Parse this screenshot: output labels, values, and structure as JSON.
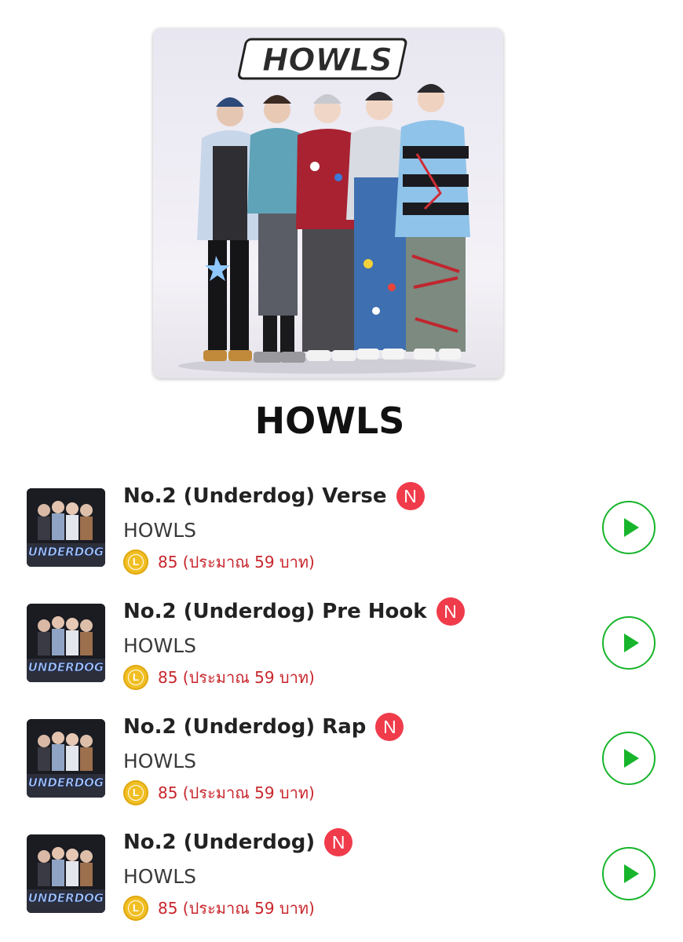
{
  "artist": {
    "logo_text": "HOWLS",
    "name": "HOWLS"
  },
  "tracks": [
    {
      "title": "No.2 (Underdog) Verse",
      "badge": "N",
      "artist": "HOWLS",
      "coin_letter": "L",
      "price": "85 (ประมาณ 59 บาท)",
      "cover_text": "UNDERDOG"
    },
    {
      "title": "No.2 (Underdog) Pre Hook",
      "badge": "N",
      "artist": "HOWLS",
      "coin_letter": "L",
      "price": "85 (ประมาณ 59 บาท)",
      "cover_text": "UNDERDOG"
    },
    {
      "title": "No.2 (Underdog) Rap",
      "badge": "N",
      "artist": "HOWLS",
      "coin_letter": "L",
      "price": "85 (ประมาณ 59 บาท)",
      "cover_text": "UNDERDOG"
    },
    {
      "title": "No.2 (Underdog)",
      "badge": "N",
      "artist": "HOWLS",
      "coin_letter": "L",
      "price": "85 (ประมาณ 59 บาท)",
      "cover_text": "UNDERDOG"
    }
  ],
  "colors": {
    "new_badge": "#f03b4b",
    "price_text": "#c8262c",
    "play_green": "#17b52b",
    "coin_gold": "#f1bf24"
  },
  "icons": {
    "badge": "new-badge-icon",
    "coin": "coin-icon",
    "play": "play-icon"
  }
}
